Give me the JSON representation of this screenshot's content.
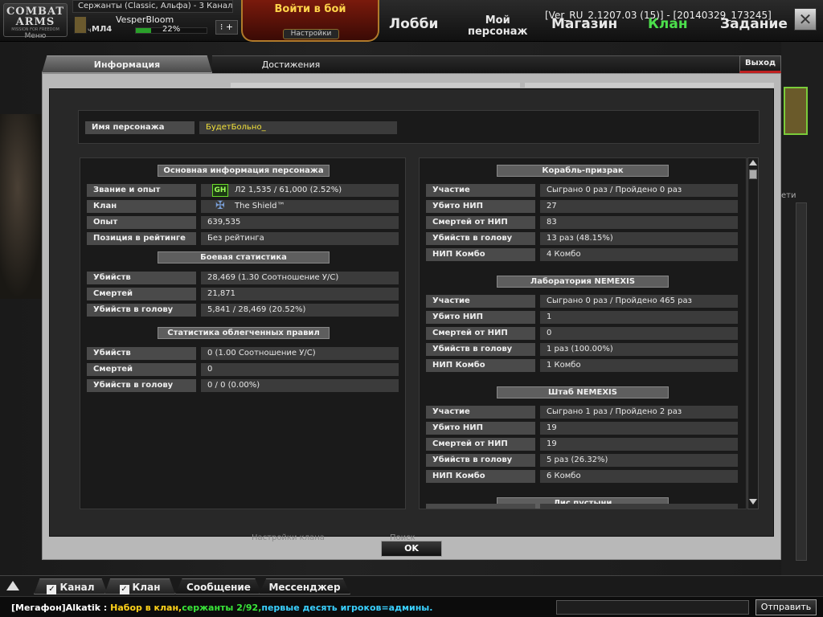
{
  "top": {
    "logo": {
      "line1": "COMBAT",
      "line2": "ARMS",
      "tagline": "MISSION FOR FREEDOM",
      "menu": "Меню"
    },
    "server": "Сержанты (Classic, Альфа) - 3 Канал",
    "player": {
      "rank_prefix": "ч",
      "rank": "МЛ4",
      "nickname": "VesperBloom",
      "xp_percent": "22%",
      "xp_fraction": 0.22,
      "plus_button": "+"
    },
    "battle_button": "Войти в бой",
    "battle_settings": "Настройки",
    "nav": {
      "lobby": "Лобби",
      "my_char_1": "Мой",
      "my_char_2": "персонаж",
      "shop": "Магазин",
      "clan": "Клан",
      "missions": "Задание"
    },
    "version": "[Ver_RU_2.1207.03 (15)] - [20140329_173245]"
  },
  "dialog": {
    "tab_info": "Информация",
    "tab_achievements": "Достижения",
    "exit": "Выход",
    "ok": "OK",
    "ghost_left": "Настройки клана",
    "ghost_right": "Поиск клана",
    "bg_right_label": "ети",
    "name_label": "Имя персонажа",
    "name_value": "БудетБольно_",
    "left": {
      "basic_title": "Основная информация персонажа",
      "basic_rows": [
        {
          "label": "Звание и опыт",
          "value": "Л2  1,535 / 61,000 (2.52%)"
        },
        {
          "label": "Клан",
          "value": "The Shield™"
        },
        {
          "label": "Опыт",
          "value": "639,535"
        },
        {
          "label": "Позиция в рейтинге",
          "value": "Без рейтинга"
        }
      ],
      "rank_badge": "GH",
      "combat_title": "Боевая статистика",
      "combat_rows": [
        {
          "label": "Убийств",
          "value": "28,469 (1.30 Соотношение У/С)"
        },
        {
          "label": "Смертей",
          "value": "21,871"
        },
        {
          "label": "Убийств в голову",
          "value": "5,841 / 28,469 (20.52%)"
        }
      ],
      "light_title": "Статистика облегченных правил",
      "light_rows": [
        {
          "label": "Убийств",
          "value": "0 (1.00 Соотношение У/С)"
        },
        {
          "label": "Смертей",
          "value": "0"
        },
        {
          "label": "Убийств в голову",
          "value": "0 / 0 (0.00%)"
        }
      ]
    },
    "right": {
      "sections": [
        {
          "title": "Корабль-призрак",
          "rows": [
            {
              "label": "Участие",
              "value": "Сыграно 0 раз / Пройдено 0 раз"
            },
            {
              "label": "Убито НИП",
              "value": "27"
            },
            {
              "label": "Смертей от НИП",
              "value": "83"
            },
            {
              "label": "Убийств в голову",
              "value": "13 раз (48.15%)"
            },
            {
              "label": "НИП Комбо",
              "value": "4 Комбо"
            }
          ]
        },
        {
          "title": "Лаборатория NEMEXIS",
          "rows": [
            {
              "label": "Участие",
              "value": "Сыграно 0 раз / Пройдено 465 раз"
            },
            {
              "label": "Убито НИП",
              "value": "1"
            },
            {
              "label": "Смертей от НИП",
              "value": "0"
            },
            {
              "label": "Убийств в голову",
              "value": "1 раз (100.00%)"
            },
            {
              "label": "НИП Комбо",
              "value": "1 Комбо"
            }
          ]
        },
        {
          "title": "Штаб NEMEXIS",
          "rows": [
            {
              "label": "Участие",
              "value": "Сыграно 1 раз / Пройдено 2 раз"
            },
            {
              "label": "Убито НИП",
              "value": "19"
            },
            {
              "label": "Смертей от НИП",
              "value": "19"
            },
            {
              "label": "Убийств в голову",
              "value": "5 раз (26.32%)"
            },
            {
              "label": "НИП Комбо",
              "value": "6 Комбо"
            }
          ]
        },
        {
          "title": "Лис пустыни",
          "rows": []
        }
      ]
    }
  },
  "chat": {
    "tabs": {
      "channel": "Канал",
      "clan": "Клан",
      "message": "Сообщение",
      "messenger": "Мессенджер"
    },
    "check_mark": "✓",
    "message": {
      "sender": "[Мегафон]Alkatik",
      "sep": " : ",
      "part1": "Набор в клан,",
      "part2": "сержанты 2/92,",
      "part3": "первые десять игроков=админы."
    },
    "colors": {
      "sender": "#ffffff",
      "part1": "#ffd21a",
      "part2": "#39e639",
      "part3": "#3ad0ff"
    },
    "send": "Отправить"
  },
  "colors": {
    "accent_green": "#4ce04c",
    "name_yellow": "#f3e23a",
    "exit_red": "#c02020"
  }
}
